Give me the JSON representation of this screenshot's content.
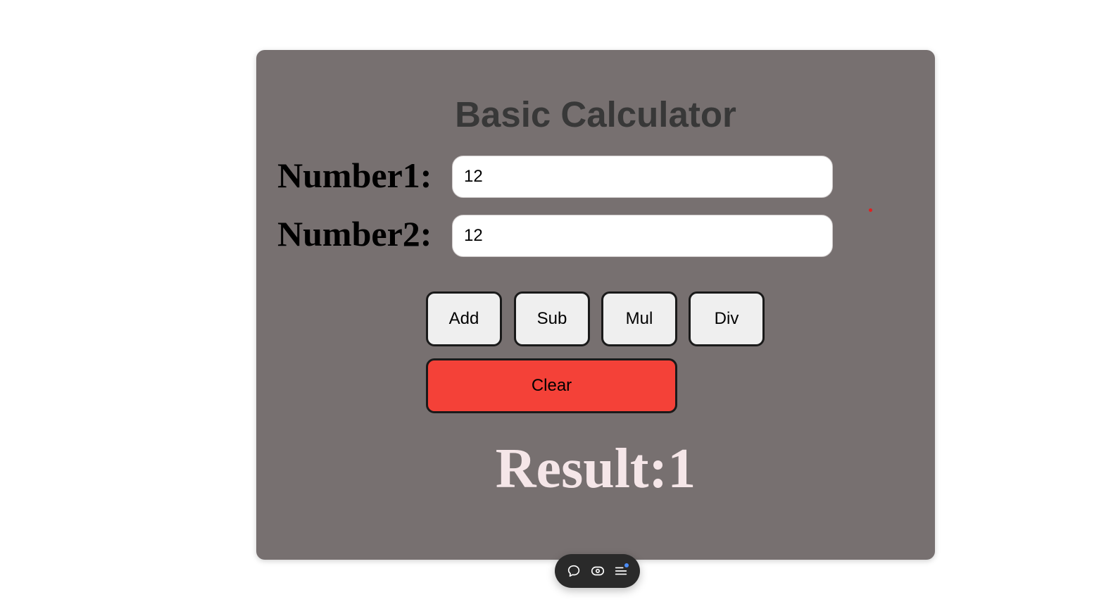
{
  "calculator": {
    "title": "Basic Calculator",
    "number1_label": "Number1:",
    "number1_value": "12",
    "number2_label": "Number2:",
    "number2_value": "12",
    "buttons": {
      "add": "Add",
      "sub": "Sub",
      "mul": "Mul",
      "div": "Div",
      "clear": "Clear"
    },
    "result_text": "Result:1"
  },
  "toolbar": {
    "icons": [
      "chat-bubble-icon",
      "eye-icon",
      "list-icon"
    ]
  },
  "colors": {
    "card_background": "#777070",
    "title": "#383838",
    "clear_button": "#f44138",
    "result_text": "#f5e6e8",
    "toolbar_background": "#2a2a2a",
    "notification_dot": "#4a8cf7"
  }
}
